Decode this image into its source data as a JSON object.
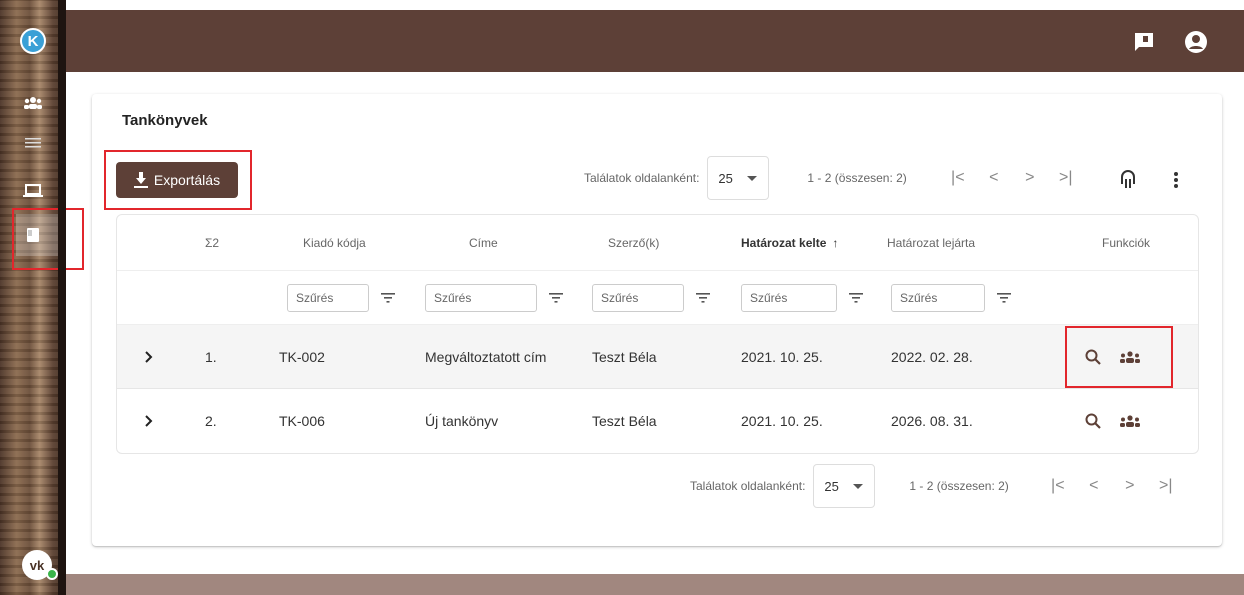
{
  "sidebar": {
    "logo": "K",
    "avatar": "vk",
    "icons": [
      "group-icon",
      "list-icon",
      "laptop-icon",
      "book-icon"
    ]
  },
  "topbar": {
    "icons": [
      "feedback-icon",
      "account-icon"
    ]
  },
  "card": {
    "title": "Tankönyvek",
    "export_label": "Exportálás",
    "page_size_label": "Találatok oldalanként:",
    "page_size": "25",
    "range": "1 - 2 (összesen: 2)"
  },
  "table": {
    "columns": [
      "Σ2",
      "Kiadó kódja",
      "Címe",
      "Szerző(k)",
      "Határozat kelte",
      "Határozat lejárta",
      "Funkciók"
    ],
    "sort_indicator": "↑",
    "filter_placeholder": "Szűrés",
    "rows": [
      {
        "index": "1.",
        "code": "TK-002",
        "title": "Megváltoztatott cím",
        "author": "Teszt Béla",
        "date": "2021. 10. 25.",
        "expiry": "2022. 02. 28."
      },
      {
        "index": "2.",
        "code": "TK-006",
        "title": "Új tankönyv",
        "author": "Teszt Béla",
        "date": "2021. 10. 25.",
        "expiry": "2026. 08. 31."
      }
    ]
  },
  "colors": {
    "brand": "#5d4037",
    "highlight": "#e2262c",
    "footer": "#a1877f"
  }
}
